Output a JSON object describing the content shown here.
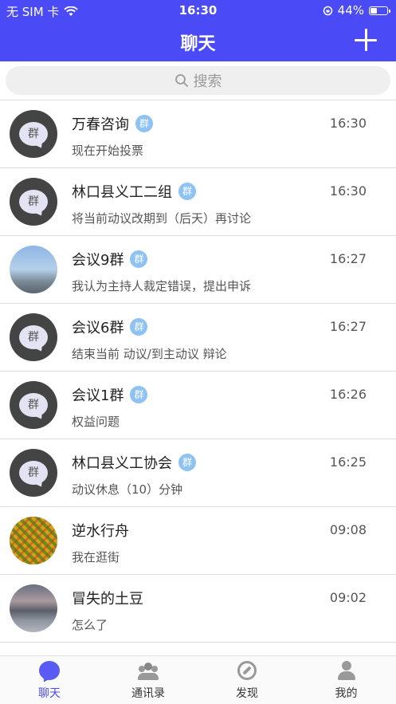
{
  "status_bar": {
    "carrier": "无 SIM 卡",
    "time": "16:30",
    "battery": "44%",
    "battery_level": 0.44
  },
  "header": {
    "title": "聊天",
    "add_icon": "plus-icon"
  },
  "search": {
    "placeholder": "搜索",
    "icon": "search-icon"
  },
  "chats": [
    {
      "name": "万春咨询",
      "group": true,
      "badge": "群",
      "time": "16:30",
      "message": "现在开始投票",
      "avatar": "group-icon"
    },
    {
      "name": "林口县义工二组",
      "group": true,
      "badge": "群",
      "time": "16:30",
      "message": "将当前动议改期到（后天）再讨论",
      "avatar": "group-icon"
    },
    {
      "name": "会议9群",
      "group": true,
      "badge": "群",
      "time": "16:27",
      "message": "我认为主持人裁定错误，提出申诉",
      "avatar": "photo"
    },
    {
      "name": "会议6群",
      "group": true,
      "badge": "群",
      "time": "16:27",
      "message": "结束当前 动议/到主动议 辩论",
      "avatar": "group-icon"
    },
    {
      "name": "会议1群",
      "group": true,
      "badge": "群",
      "time": "16:26",
      "message": "权益问题",
      "avatar": "group-icon"
    },
    {
      "name": "林口县义工协会",
      "group": true,
      "badge": "群",
      "time": "16:25",
      "message": "动议休息（10）分钟",
      "avatar": "group-icon"
    },
    {
      "name": "逆水行舟",
      "group": false,
      "badge": "",
      "time": "09:08",
      "message": "我在逛街",
      "avatar": "photo"
    },
    {
      "name": "冒失的土豆",
      "group": false,
      "badge": "",
      "time": "09:02",
      "message": "怎么了",
      "avatar": "photo"
    }
  ],
  "group_avatar_label": "群",
  "tabs": [
    {
      "label": "聊天",
      "icon": "chat-bubble-icon",
      "active": true
    },
    {
      "label": "通讯录",
      "icon": "contacts-icon",
      "active": false
    },
    {
      "label": "发现",
      "icon": "compass-icon",
      "active": false
    },
    {
      "label": "我的",
      "icon": "person-icon",
      "active": false
    }
  ],
  "colors": {
    "accent": "#4a4af7",
    "badge": "#8ec2f2"
  }
}
